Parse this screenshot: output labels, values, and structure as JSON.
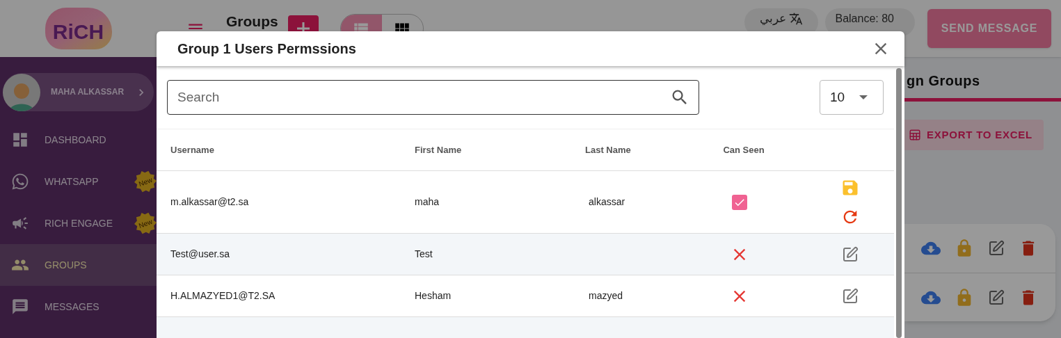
{
  "logo": "RiCH",
  "header": {
    "title": "Groups",
    "language": "عربي",
    "balance": "Balance: 80",
    "send_button": "SEND MESSAGE",
    "views": [
      {
        "kind": "list",
        "selected": true
      },
      {
        "kind": "grid",
        "selected": false
      }
    ]
  },
  "profile": {
    "name": "MAHA ALKASSAR"
  },
  "sidebar": {
    "items": [
      {
        "kind": "dashboard",
        "label": "DASHBOARD",
        "selected": false
      },
      {
        "kind": "whatsapp",
        "label": "WHATSAPP",
        "badge": "New",
        "selected": false
      },
      {
        "kind": "engage",
        "label": "RICH ENGAGE",
        "badge": "New",
        "selected": false
      },
      {
        "kind": "groups",
        "label": "GROUPS",
        "selected": true
      },
      {
        "kind": "messages",
        "label": "MESSAGES",
        "selected": false
      }
    ]
  },
  "content": {
    "tab": "gn Groups",
    "export_button": "EXPORT TO EXCEL"
  },
  "dialog": {
    "title": "Group 1 Users Permssions",
    "search": {
      "placeholder": "Search"
    },
    "page_size": "10",
    "table": {
      "columns": [
        "Username",
        "First Name",
        "Last Name",
        "Can Seen"
      ],
      "rows": [
        {
          "username": "m.alkassar@t2.sa",
          "first_name": "maha",
          "last_name": "alkassar",
          "can_seen": true,
          "editing": true
        },
        {
          "username": "Test@user.sa",
          "first_name": "Test",
          "can_seen": false,
          "editing": false
        },
        {
          "username": "H.ALMAZYED1@T2.SA",
          "first_name": "Hesham",
          "last_name": "mazyed",
          "can_seen": false,
          "editing": false
        }
      ],
      "partial_row": true
    }
  }
}
